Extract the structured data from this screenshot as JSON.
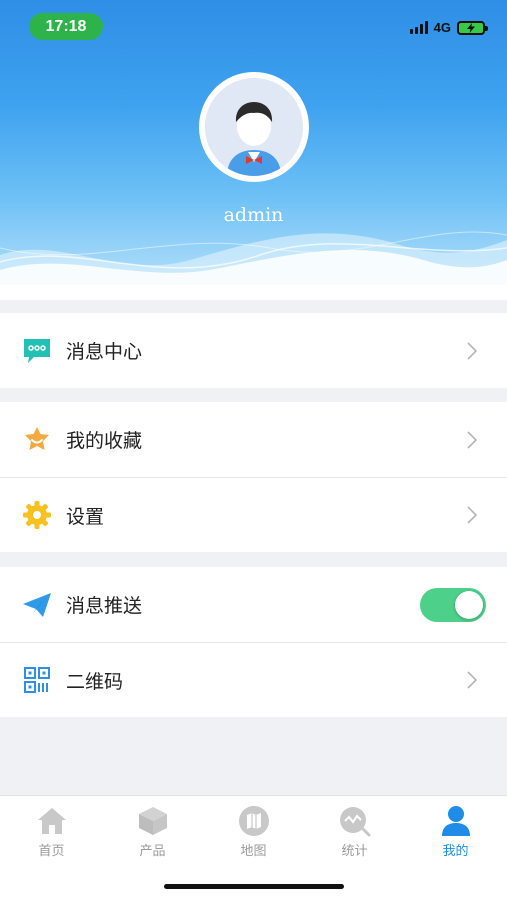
{
  "status_bar": {
    "time": "17:18",
    "network": "4G",
    "time_pill_color": "#2db34a"
  },
  "profile": {
    "username": "admin"
  },
  "menu": {
    "message_center": {
      "label": "消息中心",
      "icon": "chat-bubble-icon"
    },
    "favorites": {
      "label": "我的收藏",
      "icon": "star-badge-icon"
    },
    "settings": {
      "label": "设置",
      "icon": "gear-icon"
    },
    "push": {
      "label": "消息推送",
      "icon": "paper-plane-icon",
      "enabled": true
    },
    "qrcode": {
      "label": "二维码",
      "icon": "qr-code-icon"
    }
  },
  "tabs": [
    {
      "label": "首页",
      "icon": "home-icon"
    },
    {
      "label": "产品",
      "icon": "box-icon"
    },
    {
      "label": "地图",
      "icon": "map-icon"
    },
    {
      "label": "统计",
      "icon": "stats-search-icon"
    },
    {
      "label": "我的",
      "icon": "user-icon",
      "active": true
    }
  ],
  "colors": {
    "accent": "#1f8de8",
    "toggle_on": "#4cd08a",
    "header_top": "#2f8ee6"
  }
}
